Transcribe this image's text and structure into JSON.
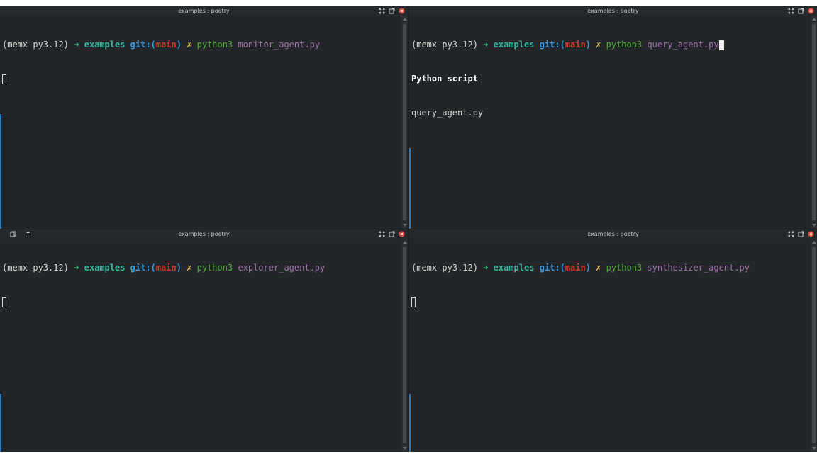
{
  "panes": [
    {
      "id": "top-left",
      "title": "examples : poetry",
      "prompt": {
        "env": "(memx-py3.12)",
        "arrow": "➜",
        "dir": "examples",
        "git_label": "git:(",
        "branch": "main",
        "git_close": ")",
        "dirty": "✗",
        "cmd": "python3",
        "arg": "monitor_agent.py"
      },
      "output": []
    },
    {
      "id": "top-right",
      "title": "examples : poetry",
      "prompt": {
        "env": "(memx-py3.12)",
        "arrow": "➜",
        "dir": "examples",
        "git_label": "git:(",
        "branch": "main",
        "git_close": ")",
        "dirty": "✗",
        "cmd": "python3",
        "arg": "query_agent.py"
      },
      "output": [
        "Python script",
        "query_agent.py"
      ]
    },
    {
      "id": "bottom-left",
      "title": "examples : poetry",
      "prompt": {
        "env": "(memx-py3.12)",
        "arrow": "➜",
        "dir": "examples",
        "git_label": "git:(",
        "branch": "main",
        "git_close": ")",
        "dirty": "✗",
        "cmd": "python3",
        "arg": "explorer_agent.py"
      },
      "output": []
    },
    {
      "id": "bottom-right",
      "title": "examples : poetry",
      "prompt": {
        "env": "(memx-py3.12)",
        "arrow": "➜",
        "dir": "examples",
        "git_label": "git:(",
        "branch": "main",
        "git_close": ")",
        "dirty": "✗",
        "cmd": "python3",
        "arg": "synthesizer_agent.py"
      },
      "output": []
    }
  ],
  "icons": {
    "maximize": "maximize-icon",
    "detach": "detach-icon",
    "close": "close-icon",
    "copy": "copy-icon",
    "paste": "paste-icon"
  },
  "colors": {
    "background": "#232628",
    "arrow": "#2fd17c",
    "dir": "#34b8a0",
    "git": "#3d9ae0",
    "branch": "#d03a2f",
    "dirty": "#e8c34a",
    "command": "#4fa83a",
    "argument": "#9e6fa8"
  }
}
